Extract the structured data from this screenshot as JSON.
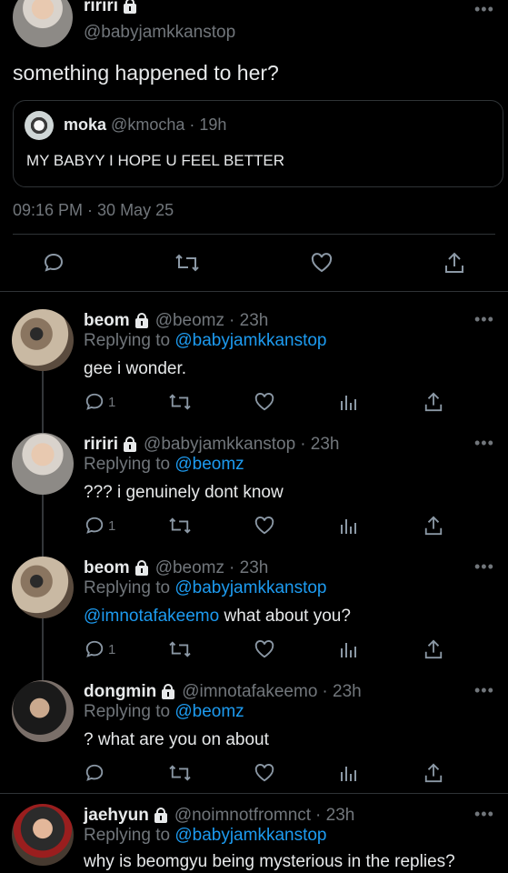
{
  "main_tweet": {
    "author_name": "ririri",
    "author_handle": "@babyjamkkanstop",
    "text": "something happened to her?",
    "quote": {
      "author_name": "moka",
      "author_handle": "@kmocha",
      "time": "· 19h",
      "text": "MY BABYY I HOPE U FEEL BETTER"
    },
    "timestamp": "09:16 PM · 30 May 25"
  },
  "replies": [
    {
      "name": "beom",
      "handle": "@beomz",
      "time": "· 23h",
      "replying_prefix": "Replying to",
      "replying_to": "@babyjamkkanstop",
      "mention": "",
      "text": "gee i wonder.",
      "reply_count": "1"
    },
    {
      "name": "ririri",
      "handle": "@babyjamkkanstop",
      "time": "· 23h",
      "replying_prefix": "Replying to",
      "replying_to": "@beomz",
      "mention": "",
      "text": "??? i genuinely dont know",
      "reply_count": "1"
    },
    {
      "name": "beom",
      "handle": "@beomz",
      "time": "· 23h",
      "replying_prefix": "Replying to",
      "replying_to": "@babyjamkkanstop",
      "mention": "@imnotafakeemo",
      "text": "what about you?",
      "reply_count": "1"
    },
    {
      "name": "dongmin",
      "handle": "@imnotafakeemo",
      "time": "· 23h",
      "replying_prefix": "Replying to",
      "replying_to": "@beomz",
      "mention": "",
      "text": "? what are you on about",
      "reply_count": ""
    },
    {
      "name": "jaehyun",
      "handle": "@noimnotfromnct",
      "time": "· 23h",
      "replying_prefix": "Replying to",
      "replying_to": "@babyjamkkanstop",
      "mention": "",
      "text": "why is beomgyu being mysterious in the replies?",
      "reply_count": ""
    }
  ],
  "more_label": "•••",
  "colors": {
    "background": "#000000",
    "text": "#e7e9ea",
    "muted": "#71767b",
    "link": "#1d9bf0",
    "divider": "#2f3336"
  }
}
